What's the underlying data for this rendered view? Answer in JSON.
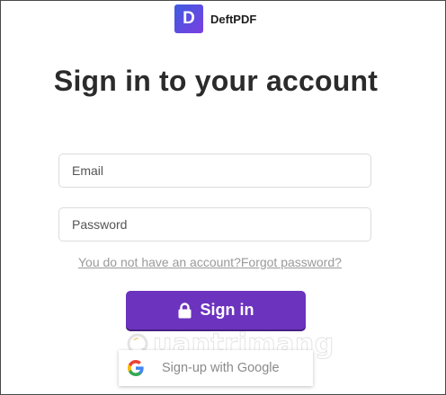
{
  "brand": {
    "logo_letter": "D",
    "name": "DeftPDF"
  },
  "page": {
    "title": "Sign in to your account"
  },
  "form": {
    "email_placeholder": "Email",
    "password_placeholder": "Password",
    "no_account_link": "You do not have an account?",
    "forgot_password_link": "Forgot password?",
    "signin_label": "Sign in",
    "google_label": "Sign-up with Google"
  },
  "colors": {
    "accent": "#6c33be",
    "logo_gradient_start": "#3e5ce0",
    "logo_gradient_end": "#7a3fe0"
  },
  "icons": {
    "signin": "lock-icon",
    "google": "google-icon"
  },
  "watermark": {
    "text": "uantrimang"
  }
}
